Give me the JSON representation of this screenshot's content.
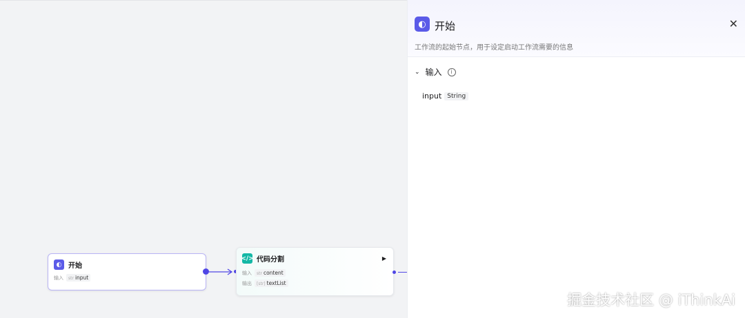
{
  "canvas": {
    "start_node": {
      "title": "开始",
      "input_label": "输入",
      "input_type": "str",
      "input_name": "input"
    },
    "code_node": {
      "title": "代码分割",
      "input_label": "输入",
      "input_type": "str",
      "input_name": "content",
      "output_label": "输出",
      "output_type": "[str]",
      "output_name": "textList"
    }
  },
  "panel": {
    "title": "开始",
    "description": "工作流的起始节点，用于设定启动工作流需要的信息",
    "section": "输入",
    "variable": {
      "name": "input",
      "type": "String"
    }
  },
  "watermark": "掘金技术社区 @ iThinkAi",
  "colors": {
    "accent": "#4f46e5",
    "code": "#14b8a6"
  }
}
